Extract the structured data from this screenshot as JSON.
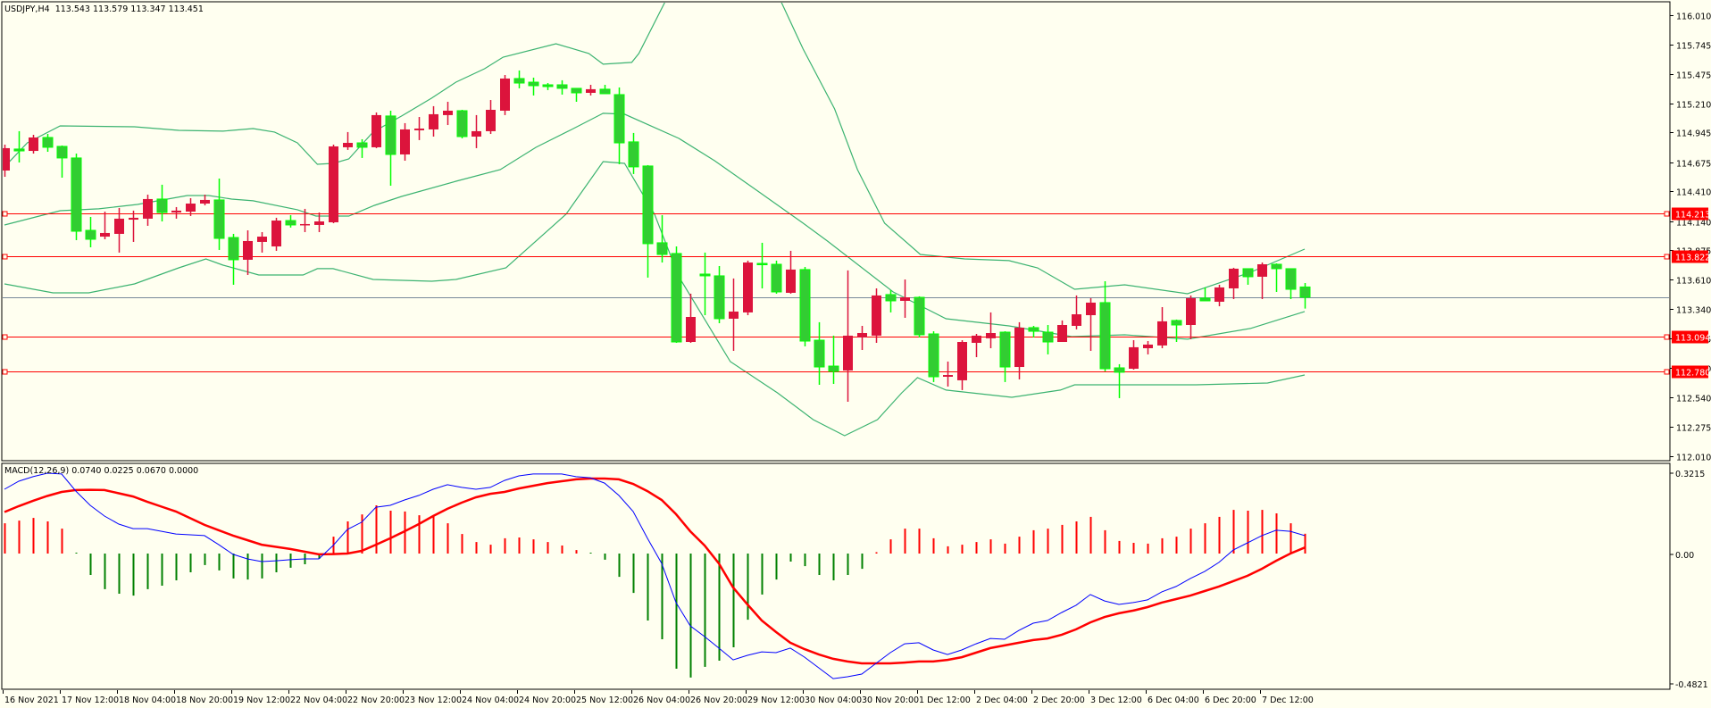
{
  "header": {
    "symbol": "USDJPY,H4",
    "ohlc": "113.543 113.579 113.347 113.451"
  },
  "macd_header": {
    "name": "MACD(12,26,9)",
    "values": "0.0740 0.0225 0.0670 0.0000"
  },
  "colors": {
    "background": "#fffff0",
    "bull": "#dc143c",
    "bear_body": "#32cd32",
    "bear_outline": "#00ff00",
    "bands": "#3cb371",
    "level": "#ff0000",
    "bid": "#778899",
    "macd_main": "#0000ff",
    "macd_signal": "#ff0000",
    "hist_pos": "#ff0000",
    "hist_neg": "#008000"
  },
  "chart_data": {
    "type": "candlestick",
    "symbol": "USDJPY",
    "timeframe": "H4",
    "price_axis": {
      "range": [
        112.01,
        116.01
      ],
      "ticks": [
        "116.010",
        "115.745",
        "115.475",
        "115.210",
        "114.945",
        "114.675",
        "114.410",
        "114.140",
        "113.875",
        "113.610",
        "113.340",
        "113.075",
        "112.810",
        "112.540",
        "112.275",
        "112.010"
      ]
    },
    "time_labels": [
      "16 Nov 2021",
      "17 Nov 12:00",
      "18 Nov 04:00",
      "18 Nov 20:00",
      "19 Nov 12:00",
      "22 Nov 04:00",
      "22 Nov 20:00",
      "23 Nov 12:00",
      "24 Nov 04:00",
      "24 Nov 20:00",
      "25 Nov 12:00",
      "26 Nov 04:00",
      "26 Nov 20:00",
      "29 Nov 12:00",
      "30 Nov 04:00",
      "30 Nov 20:00",
      "1 Dec 12:00",
      "2 Dec 04:00",
      "2 Dec 20:00",
      "3 Dec 12:00",
      "6 Dec 04:00",
      "6 Dec 20:00",
      "7 Dec 12:00"
    ],
    "levels": [
      {
        "price": "114.213"
      },
      {
        "price": "113.822"
      },
      {
        "price": "113.094"
      },
      {
        "price": "112.780"
      }
    ],
    "bid": "113.451",
    "ohlc": [
      [
        114.6,
        114.835,
        114.543,
        114.803
      ],
      [
        114.795,
        114.957,
        114.673,
        114.778
      ],
      [
        114.778,
        114.924,
        114.754,
        114.9
      ],
      [
        114.9,
        114.932,
        114.77,
        114.811
      ],
      [
        114.819,
        114.827,
        114.535,
        114.714
      ],
      [
        114.714,
        114.754,
        113.968,
        114.049
      ],
      [
        114.057,
        114.179,
        113.903,
        113.976
      ],
      [
        114.0,
        114.227,
        113.976,
        114.033
      ],
      [
        114.025,
        114.26,
        113.855,
        114.163
      ],
      [
        114.154,
        114.236,
        113.952,
        114.171
      ],
      [
        114.163,
        114.381,
        114.098,
        114.341
      ],
      [
        114.341,
        114.471,
        114.138,
        114.219
      ],
      [
        114.219,
        114.268,
        114.163,
        114.236
      ],
      [
        114.227,
        114.349,
        114.187,
        114.3
      ],
      [
        114.3,
        114.381,
        114.284,
        114.333
      ],
      [
        114.333,
        114.527,
        113.879,
        113.984
      ],
      [
        113.992,
        114.025,
        113.563,
        113.79
      ],
      [
        113.79,
        114.057,
        113.652,
        113.96
      ],
      [
        113.952,
        114.041,
        113.855,
        114.0
      ],
      [
        113.911,
        114.171,
        113.871,
        114.146
      ],
      [
        114.146,
        114.195,
        114.082,
        114.106
      ],
      [
        114.106,
        114.252,
        114.041,
        114.114
      ],
      [
        114.106,
        114.219,
        114.041,
        114.138
      ],
      [
        114.13,
        114.835,
        114.122,
        114.819
      ],
      [
        114.811,
        114.949,
        114.787,
        114.851
      ],
      [
        114.851,
        114.884,
        114.714,
        114.811
      ],
      [
        114.811,
        115.127,
        114.803,
        115.103
      ],
      [
        115.095,
        115.143,
        114.462,
        114.746
      ],
      [
        114.746,
        115.03,
        114.689,
        114.973
      ],
      [
        114.965,
        115.086,
        114.876,
        114.981
      ],
      [
        114.973,
        115.184,
        114.908,
        115.111
      ],
      [
        115.103,
        115.224,
        115.013,
        115.143
      ],
      [
        115.143,
        115.151,
        114.892,
        114.908
      ],
      [
        114.908,
        115.103,
        114.803,
        114.957
      ],
      [
        114.957,
        115.24,
        114.932,
        115.151
      ],
      [
        115.143,
        115.467,
        115.103,
        115.435
      ],
      [
        115.435,
        115.508,
        115.346,
        115.394
      ],
      [
        115.402,
        115.443,
        115.281,
        115.37
      ],
      [
        115.378,
        115.394,
        115.33,
        115.362
      ],
      [
        115.378,
        115.419,
        115.289,
        115.346
      ],
      [
        115.346,
        115.346,
        115.224,
        115.305
      ],
      [
        115.305,
        115.378,
        115.281,
        115.338
      ],
      [
        115.338,
        115.378,
        115.297,
        115.297
      ],
      [
        115.289,
        115.354,
        114.657,
        114.851
      ],
      [
        114.86,
        114.941,
        114.568,
        114.633
      ],
      [
        114.641,
        114.649,
        113.628,
        113.936
      ],
      [
        113.944,
        114.195,
        113.765,
        113.838
      ],
      [
        113.847,
        113.911,
        113.036,
        113.044
      ],
      [
        113.044,
        113.482,
        113.036,
        113.271
      ],
      [
        113.66,
        113.855,
        113.287,
        113.644
      ],
      [
        113.644,
        113.733,
        113.214,
        113.255
      ],
      [
        113.255,
        113.62,
        112.963,
        113.32
      ],
      [
        113.312,
        113.782,
        113.287,
        113.765
      ],
      [
        113.757,
        113.944,
        113.53,
        113.749
      ],
      [
        113.749,
        113.782,
        113.482,
        113.498
      ],
      [
        113.49,
        113.871,
        113.482,
        113.701
      ],
      [
        113.701,
        113.725,
        113.004,
        113.052
      ],
      [
        113.06,
        113.223,
        112.655,
        112.817
      ],
      [
        112.825,
        113.101,
        112.663,
        112.777
      ],
      [
        112.785,
        113.693,
        112.501,
        113.101
      ],
      [
        113.085,
        113.19,
        112.971,
        113.125
      ],
      [
        113.101,
        113.53,
        113.036,
        113.466
      ],
      [
        113.474,
        113.514,
        113.312,
        113.417
      ],
      [
        113.417,
        113.611,
        113.263,
        113.449
      ],
      [
        113.449,
        113.458,
        113.085,
        113.109
      ],
      [
        113.117,
        113.141,
        112.68,
        112.728
      ],
      [
        112.728,
        112.866,
        112.639,
        112.744
      ],
      [
        112.696,
        113.06,
        112.607,
        113.044
      ],
      [
        113.036,
        113.117,
        112.906,
        113.101
      ],
      [
        113.077,
        113.312,
        112.987,
        113.125
      ],
      [
        113.133,
        113.141,
        112.68,
        112.817
      ],
      [
        112.817,
        113.223,
        112.704,
        113.174
      ],
      [
        113.174,
        113.19,
        113.085,
        113.141
      ],
      [
        113.133,
        113.198,
        112.931,
        113.044
      ],
      [
        113.044,
        113.239,
        113.044,
        113.198
      ],
      [
        113.19,
        113.466,
        113.158,
        113.295
      ],
      [
        113.287,
        113.441,
        112.963,
        113.401
      ],
      [
        113.401,
        113.595,
        112.777,
        112.801
      ],
      [
        112.809,
        112.842,
        112.534,
        112.769
      ],
      [
        112.801,
        113.06,
        112.793,
        112.996
      ],
      [
        112.987,
        113.052,
        112.931,
        113.02
      ],
      [
        113.012,
        113.36,
        112.987,
        113.231
      ],
      [
        113.239,
        113.247,
        113.044,
        113.198
      ],
      [
        113.198,
        113.466,
        113.069,
        113.441
      ],
      [
        113.441,
        113.539,
        113.417,
        113.417
      ],
      [
        113.409,
        113.563,
        113.368,
        113.539
      ],
      [
        113.53,
        113.717,
        113.433,
        113.709
      ],
      [
        113.709,
        113.709,
        113.563,
        113.636
      ],
      [
        113.636,
        113.765,
        113.433,
        113.749
      ],
      [
        113.749,
        113.757,
        113.498,
        113.709
      ],
      [
        113.709,
        113.709,
        113.433,
        113.522
      ],
      [
        113.543,
        113.579,
        113.347,
        113.451
      ]
    ],
    "bollinger": {
      "upper": [
        [
          0,
          114.633
        ],
        [
          1.6,
          114.851
        ],
        [
          3.9,
          115.005
        ],
        [
          9.1,
          114.997
        ],
        [
          12.2,
          114.965
        ],
        [
          15.3,
          114.957
        ],
        [
          17.4,
          114.981
        ],
        [
          18.9,
          114.949
        ],
        [
          20.5,
          114.851
        ],
        [
          21.9,
          114.657
        ],
        [
          23.0,
          114.665
        ],
        [
          24.1,
          114.705
        ],
        [
          25.8,
          114.949
        ],
        [
          27.8,
          115.095
        ],
        [
          29.9,
          115.257
        ],
        [
          31.6,
          115.402
        ],
        [
          33.6,
          115.524
        ],
        [
          34.9,
          115.629
        ],
        [
          38.6,
          115.751
        ],
        [
          40.9,
          115.662
        ],
        [
          41.9,
          115.565
        ],
        [
          43.9,
          115.581
        ],
        [
          44.4,
          115.662
        ],
        [
          46.3,
          116.148
        ],
        [
          48.1,
          116.553
        ],
        [
          50.9,
          116.715
        ],
        [
          52.8,
          116.472
        ],
        [
          54.3,
          116.148
        ],
        [
          55.9,
          115.702
        ],
        [
          58.1,
          115.159
        ],
        [
          59.7,
          114.608
        ],
        [
          61.6,
          114.122
        ],
        [
          64.1,
          113.838
        ],
        [
          67.2,
          113.798
        ],
        [
          70.3,
          113.782
        ],
        [
          72.3,
          113.717
        ],
        [
          74.9,
          113.522
        ],
        [
          78.4,
          113.563
        ],
        [
          82.8,
          113.482
        ],
        [
          87.2,
          113.676
        ],
        [
          91,
          113.887
        ]
      ],
      "middle": [
        [
          0,
          114.106
        ],
        [
          3.9,
          114.235
        ],
        [
          6.6,
          114.252
        ],
        [
          9.3,
          114.292
        ],
        [
          12.8,
          114.373
        ],
        [
          14.3,
          114.373
        ],
        [
          15.9,
          114.341
        ],
        [
          17.4,
          114.325
        ],
        [
          20.5,
          114.244
        ],
        [
          21.8,
          114.187
        ],
        [
          24.1,
          114.187
        ],
        [
          25.9,
          114.284
        ],
        [
          27.8,
          114.365
        ],
        [
          31.6,
          114.503
        ],
        [
          34.7,
          114.608
        ],
        [
          37.2,
          114.811
        ],
        [
          39.7,
          114.973
        ],
        [
          41.9,
          115.119
        ],
        [
          43.4,
          115.111
        ],
        [
          47.2,
          114.892
        ],
        [
          49.7,
          114.689
        ],
        [
          52.8,
          114.406
        ],
        [
          55.9,
          114.122
        ],
        [
          57.6,
          113.96
        ],
        [
          62.2,
          113.498
        ],
        [
          65.9,
          113.255
        ],
        [
          70.3,
          113.19
        ],
        [
          74.7,
          113.093
        ],
        [
          78.4,
          113.109
        ],
        [
          82.8,
          113.069
        ],
        [
          87.2,
          113.166
        ],
        [
          91,
          113.32
        ]
      ],
      "lower": [
        [
          0,
          113.571
        ],
        [
          3.4,
          113.49
        ],
        [
          5.9,
          113.49
        ],
        [
          9.1,
          113.571
        ],
        [
          12.2,
          113.717
        ],
        [
          14.1,
          113.798
        ],
        [
          15.3,
          113.741
        ],
        [
          17.8,
          113.652
        ],
        [
          20.9,
          113.652
        ],
        [
          21.9,
          113.709
        ],
        [
          23.0,
          113.709
        ],
        [
          25.8,
          113.611
        ],
        [
          29.9,
          113.595
        ],
        [
          31.6,
          113.611
        ],
        [
          35.1,
          113.717
        ],
        [
          39.3,
          114.203
        ],
        [
          41.9,
          114.681
        ],
        [
          43.4,
          114.665
        ],
        [
          45.5,
          114.203
        ],
        [
          47.2,
          113.636
        ],
        [
          50.8,
          112.866
        ],
        [
          54.1,
          112.582
        ],
        [
          56.6,
          112.339
        ],
        [
          58.8,
          112.193
        ],
        [
          61.1,
          112.339
        ],
        [
          62.8,
          112.582
        ],
        [
          63.9,
          112.72
        ],
        [
          65.9,
          112.607
        ],
        [
          70.5,
          112.542
        ],
        [
          73.9,
          112.607
        ],
        [
          74.9,
          112.655
        ],
        [
          83.4,
          112.655
        ],
        [
          88.4,
          112.671
        ],
        [
          91,
          112.744
        ]
      ]
    },
    "macd": {
      "axis_labels": [
        "0.3215",
        "0.00",
        "-0.4821"
      ],
      "range": [
        -0.4821,
        0.3215
      ],
      "histogram": [
        0.113,
        0.123,
        0.133,
        0.12,
        0.093,
        -0.003,
        -0.08,
        -0.133,
        -0.15,
        -0.157,
        -0.133,
        -0.12,
        -0.1,
        -0.07,
        -0.043,
        -0.063,
        -0.093,
        -0.097,
        -0.093,
        -0.07,
        -0.053,
        -0.04,
        -0.02,
        0.063,
        0.12,
        0.146,
        0.18,
        0.16,
        0.157,
        0.143,
        0.14,
        0.113,
        0.073,
        0.043,
        0.033,
        0.057,
        0.06,
        0.053,
        0.043,
        0.03,
        0.013,
        -0.002,
        -0.023,
        -0.087,
        -0.147,
        -0.25,
        -0.32,
        -0.43,
        -0.463,
        -0.423,
        -0.4,
        -0.35,
        -0.247,
        -0.153,
        -0.097,
        -0.03,
        -0.047,
        -0.08,
        -0.1,
        -0.08,
        -0.057,
        0.005,
        0.053,
        0.093,
        0.093,
        0.057,
        0.027,
        0.033,
        0.043,
        0.053,
        0.037,
        0.063,
        0.087,
        0.093,
        0.107,
        0.12,
        0.137,
        0.087,
        0.047,
        0.04,
        0.037,
        0.057,
        0.063,
        0.093,
        0.113,
        0.137,
        0.163,
        0.16,
        0.163,
        0.15,
        0.113,
        0.074
      ],
      "main": [
        0.24,
        0.27,
        0.287,
        0.3,
        0.297,
        0.233,
        0.18,
        0.14,
        0.11,
        0.093,
        0.093,
        0.083,
        0.073,
        0.07,
        0.067,
        0.033,
        -0.003,
        -0.02,
        -0.03,
        -0.027,
        -0.023,
        -0.02,
        -0.02,
        0.03,
        0.09,
        0.117,
        0.173,
        0.18,
        0.2,
        0.217,
        0.24,
        0.257,
        0.247,
        0.24,
        0.247,
        0.273,
        0.29,
        0.297,
        0.297,
        0.297,
        0.287,
        0.283,
        0.263,
        0.217,
        0.157,
        0.057,
        -0.037,
        -0.183,
        -0.27,
        -0.31,
        -0.353,
        -0.397,
        -0.38,
        -0.367,
        -0.37,
        -0.353,
        -0.387,
        -0.427,
        -0.467,
        -0.46,
        -0.45,
        -0.41,
        -0.37,
        -0.337,
        -0.333,
        -0.36,
        -0.377,
        -0.36,
        -0.337,
        -0.317,
        -0.32,
        -0.287,
        -0.26,
        -0.25,
        -0.22,
        -0.193,
        -0.153,
        -0.177,
        -0.19,
        -0.183,
        -0.173,
        -0.143,
        -0.123,
        -0.093,
        -0.067,
        -0.033,
        0.013,
        0.04,
        0.067,
        0.087,
        0.083,
        0.067
      ],
      "signal": [
        0.155,
        0.177,
        0.197,
        0.215,
        0.23,
        0.237,
        0.238,
        0.237,
        0.225,
        0.213,
        0.193,
        0.175,
        0.157,
        0.132,
        0.107,
        0.087,
        0.067,
        0.05,
        0.033,
        0.025,
        0.017,
        0.007,
        -0.003,
        -0.002,
        0,
        0.01,
        0.033,
        0.057,
        0.083,
        0.11,
        0.14,
        0.167,
        0.19,
        0.21,
        0.223,
        0.23,
        0.243,
        0.253,
        0.263,
        0.27,
        0.277,
        0.28,
        0.28,
        0.277,
        0.26,
        0.233,
        0.2,
        0.147,
        0.083,
        0.03,
        -0.037,
        -0.127,
        -0.19,
        -0.25,
        -0.293,
        -0.333,
        -0.357,
        -0.377,
        -0.393,
        -0.403,
        -0.41,
        -0.41,
        -0.41,
        -0.407,
        -0.403,
        -0.403,
        -0.397,
        -0.387,
        -0.37,
        -0.353,
        -0.343,
        -0.333,
        -0.323,
        -0.317,
        -0.303,
        -0.283,
        -0.257,
        -0.237,
        -0.223,
        -0.213,
        -0.2,
        -0.183,
        -0.17,
        -0.157,
        -0.14,
        -0.123,
        -0.103,
        -0.083,
        -0.057,
        -0.027,
        0,
        0.0225
      ]
    }
  }
}
